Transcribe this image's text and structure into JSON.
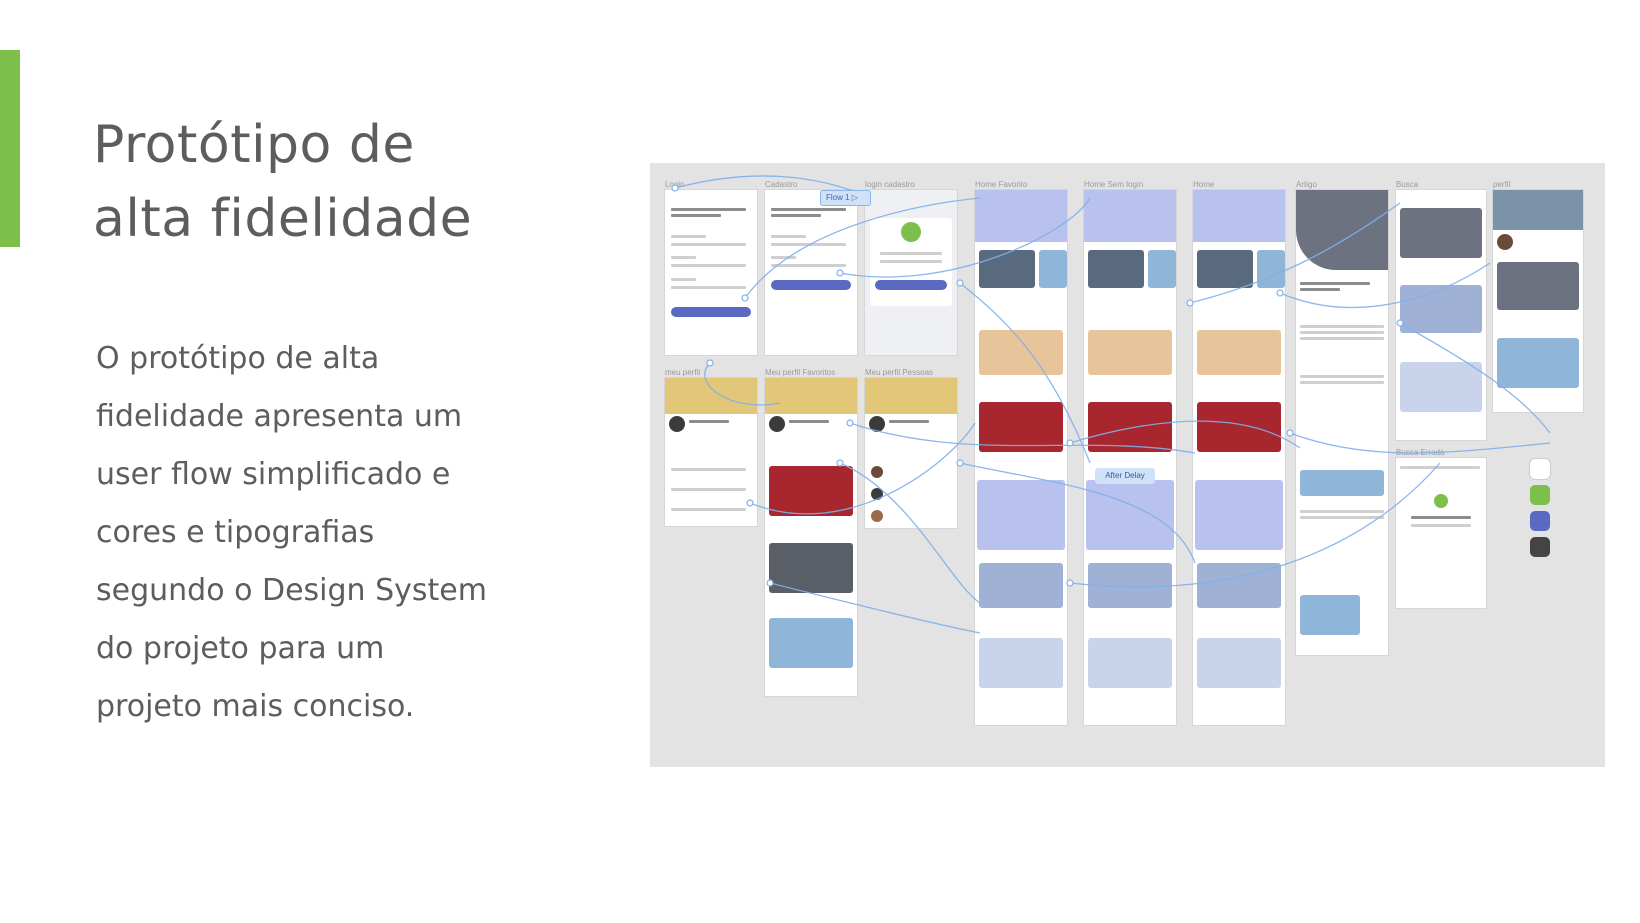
{
  "slide": {
    "title_lines": [
      "Protótipo de",
      "alta fidelidade"
    ],
    "body_lines": [
      "O protótipo de alta",
      "fidelidade apresenta um",
      "user flow simplificado e",
      "cores e tipografias",
      "segundo o Design System",
      "do projeto para um",
      "projeto mais conciso."
    ],
    "accent_color": "#7cc04b"
  },
  "prototype": {
    "frame_labels": {
      "login": "Login",
      "cadastro": "Cadastro",
      "login_cadastro": "login cadastro",
      "home_favorito": "Home Favorito",
      "home_sem_login": "Home Sem login",
      "home": "Home",
      "artigo": "Artigo",
      "busca": "Busca",
      "perfil": "perfil",
      "meu_perfil": "meu perfil",
      "meu_perfil_favoritos": "Meu perfil Favoritos",
      "meu_perfil_pessoas": "Meu perfil Pessoas",
      "busca_errada": "Busca Errada"
    },
    "flow_tag": "Flow 1",
    "delay_tag": "After Delay",
    "swatch_colors": [
      "#ffffff",
      "#7cc04b",
      "#5a6ac3",
      "#444444"
    ]
  }
}
